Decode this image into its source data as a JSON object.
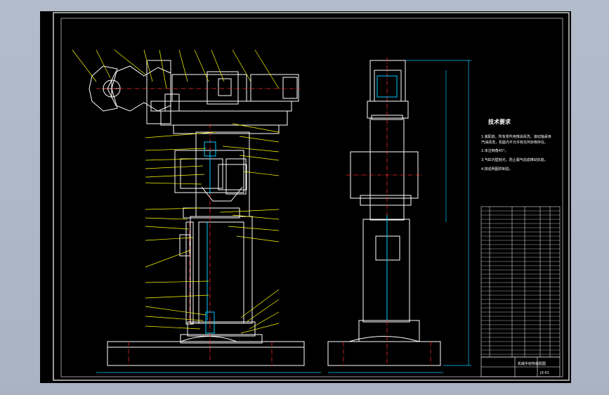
{
  "technical_requirements": {
    "heading": "技术要求",
    "lines": [
      "1.装配前，所有零件用煤油清洗，滚动轴承用",
      "汽油清洗，机座内不允许有任何杂物存在。",
      "2.未注倒角45°。",
      "3.气缸内壁抛光，防止漏气造成推动失稳。",
      "4.按说明图样制造。"
    ]
  },
  "title_block": {
    "name": "机械手结构装配图",
    "number": "JX-01"
  },
  "colors": {
    "outline": "#ffffff",
    "part": "#ffffff",
    "centerline": "#ff2a2a",
    "dimension": "#00c8ff",
    "leader": "#ffff00",
    "hatch": "#ff2a2a"
  }
}
